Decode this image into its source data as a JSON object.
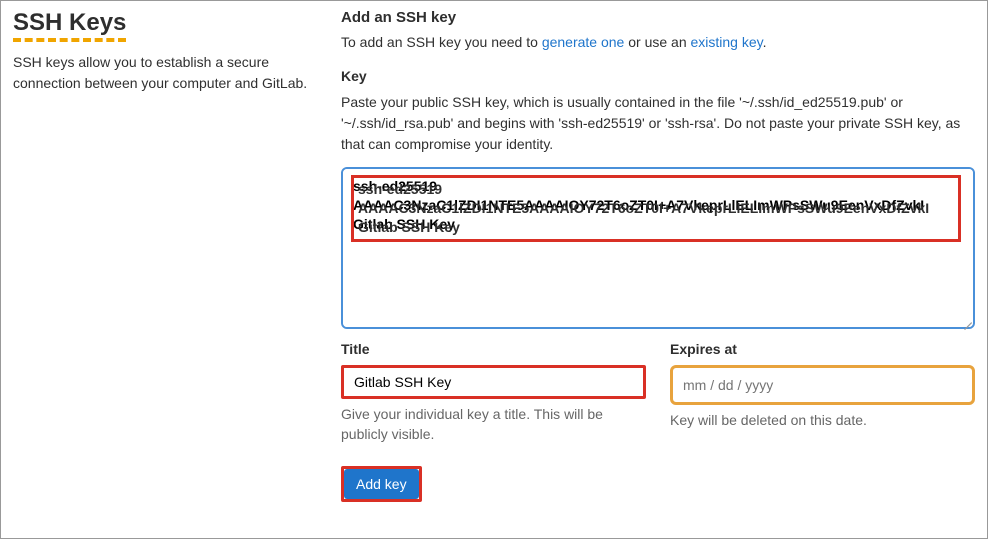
{
  "sidebar": {
    "title": "SSH Keys",
    "description": "SSH keys allow you to establish a secure connection between your computer and GitLab."
  },
  "main": {
    "heading": "Add an SSH key",
    "intro_prefix": "To add an SSH key you need to ",
    "intro_link1": "generate one",
    "intro_mid": " or use an ",
    "intro_link2": "existing key",
    "intro_suffix": ".",
    "key": {
      "label": "Key",
      "help": "Paste your public SSH key, which is usually contained in the file '~/.ssh/id_ed25519.pub' or '~/.ssh/id_rsa.pub' and begins with 'ssh-ed25519' or 'ssh-rsa'. Do not paste your private SSH key, as that can compromise your identity.",
      "value": "ssh-ed25519 AAAAC3NzaC1lZDI1NTE5AAAAIOY72T6oZT0I+A7VkeprLlELImWPsSWu9EenVxDfZvkI Gitlab SSH Key"
    },
    "title_field": {
      "label": "Title",
      "value": "Gitlab SSH Key",
      "help": "Give your individual key a title. This will be publicly visible."
    },
    "expires_field": {
      "label": "Expires at",
      "placeholder": "mm / dd / yyyy",
      "help": "Key will be deleted on this date."
    },
    "submit_label": "Add key"
  }
}
